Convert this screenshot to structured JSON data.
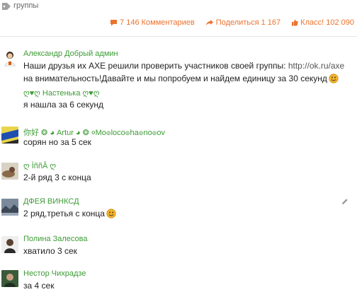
{
  "header": {
    "tag_icon": "tag-icon",
    "tag_label": "группы"
  },
  "stats": {
    "comments": "7 146 Комментариев",
    "shares": "Поделиться 1 167",
    "likes": "Класс! 102 090",
    "accent": "#eb722e"
  },
  "post": {
    "author": "Александр Добрый админ",
    "text_before": "Наши друзья их AXE решили проверить участников своей группы: ",
    "link": "http://ok.ru/axe",
    "text_after": " на внимательность!Давайте и мы попробуем и найдем единицу за 30 секунд"
  },
  "comments": [
    {
      "author": "ღ♥ღ Настенька ღ♥ღ",
      "text": "я нашла за 6 секунд"
    },
    {
      "author": "你好 ❂ ◕ Artur ◕ ❂ ०Mo๏loco๏ha๏no๏ov",
      "text": "сорян но за 5 сек"
    },
    {
      "author": "ღ ÌññÂ ღ",
      "text": "2-й ряд 3 с конца"
    },
    {
      "author": "ДФЕЯ ВИНКСД",
      "text": "2 ряд,третья с конца"
    },
    {
      "author": "Полина Залесова",
      "text": "хватило 3 сек"
    },
    {
      "author": "Нестор Чихрадзе",
      "text": "за 4 сек"
    }
  ],
  "colors": {
    "author": "#3d9b36",
    "text": "#222222",
    "separator": "#e3e3e3"
  }
}
